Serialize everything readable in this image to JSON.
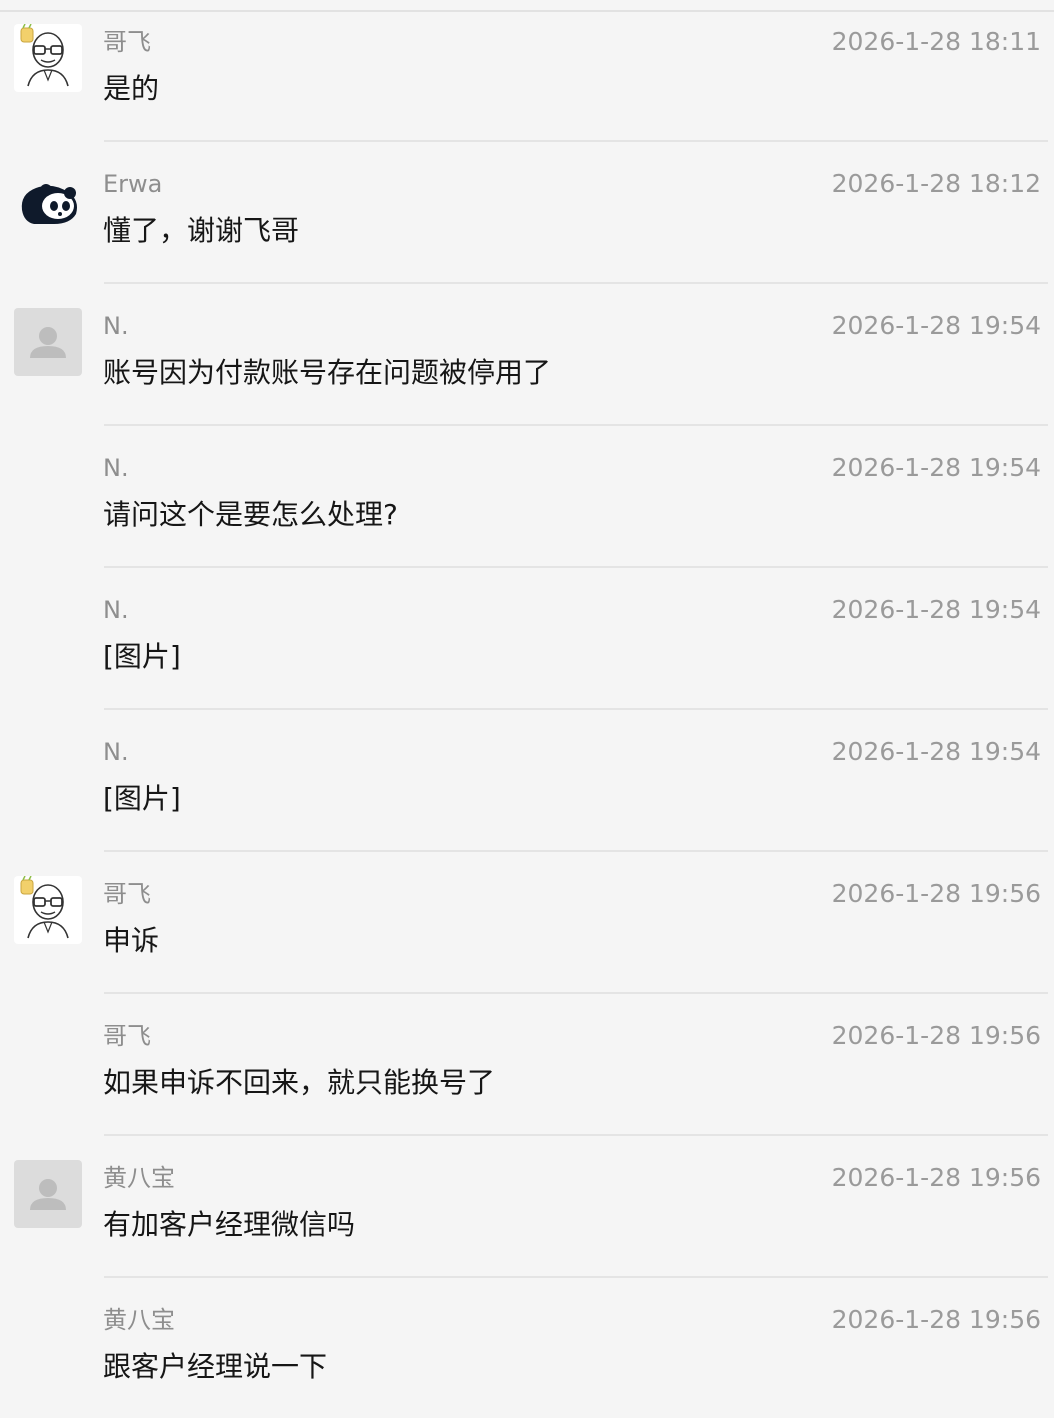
{
  "messages": [
    {
      "sender": "哥飞",
      "time": "2026-1-28 18:11",
      "text": "是的",
      "avatar": "bald-glasses-avatar"
    },
    {
      "sender": "Erwa",
      "time": "2026-1-28 18:12",
      "text": "懂了，谢谢飞哥",
      "avatar": "panda-avatar"
    },
    {
      "sender": "N.",
      "time": "2026-1-28 19:54",
      "text": "账号因为付款账号存在问题被停用了",
      "avatar": "default-user-avatar"
    },
    {
      "sender": "N.",
      "time": "2026-1-28 19:54",
      "text": "请问这个是要怎么处理?",
      "avatar": ""
    },
    {
      "sender": "N.",
      "time": "2026-1-28 19:54",
      "text": "[图片]",
      "avatar": ""
    },
    {
      "sender": "N.",
      "time": "2026-1-28 19:54",
      "text": "[图片]",
      "avatar": ""
    },
    {
      "sender": "哥飞",
      "time": "2026-1-28 19:56",
      "text": "申诉",
      "avatar": "bald-glasses-avatar"
    },
    {
      "sender": "哥飞",
      "time": "2026-1-28 19:56",
      "text": "如果申诉不回来，就只能换号了",
      "avatar": ""
    },
    {
      "sender": "黄八宝",
      "time": "2026-1-28 19:56",
      "text": "有加客户经理微信吗",
      "avatar": "default-user-avatar"
    },
    {
      "sender": "黄八宝",
      "time": "2026-1-28 19:56",
      "text": "跟客户经理说一下",
      "avatar": ""
    }
  ],
  "colors": {
    "background": "#f5f5f5",
    "sender": "#8e8e8e",
    "time": "#9a9a9a",
    "text": "#161616",
    "divider": "#e4e4e4"
  }
}
